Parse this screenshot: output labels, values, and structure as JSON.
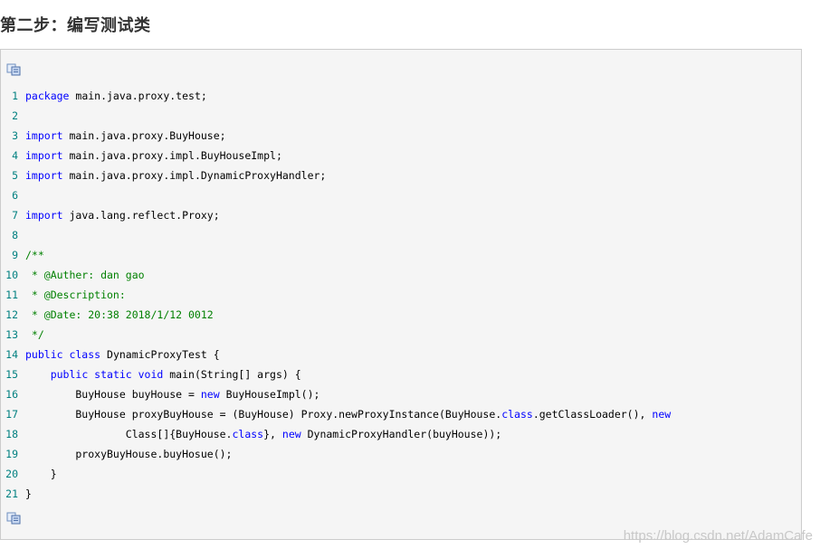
{
  "heading": "第二步：编写测试类",
  "watermark": "https://blog.csdn.net/AdamCafe",
  "copy_icon": "copy-code-icon",
  "lines": [
    {
      "n": "1",
      "tokens": [
        [
          "kw",
          "package"
        ],
        [
          "tx",
          " main.java.proxy.test;"
        ]
      ]
    },
    {
      "n": "2",
      "tokens": []
    },
    {
      "n": "3",
      "tokens": [
        [
          "kw",
          "import"
        ],
        [
          "tx",
          " main.java.proxy.BuyHouse;"
        ]
      ]
    },
    {
      "n": "4",
      "tokens": [
        [
          "kw",
          "import"
        ],
        [
          "tx",
          " main.java.proxy.impl.BuyHouseImpl;"
        ]
      ]
    },
    {
      "n": "5",
      "tokens": [
        [
          "kw",
          "import"
        ],
        [
          "tx",
          " main.java.proxy.impl.DynamicProxyHandler;"
        ]
      ]
    },
    {
      "n": "6",
      "tokens": []
    },
    {
      "n": "7",
      "tokens": [
        [
          "kw",
          "import"
        ],
        [
          "tx",
          " java.lang.reflect.Proxy;"
        ]
      ]
    },
    {
      "n": "8",
      "tokens": []
    },
    {
      "n": "9",
      "tokens": [
        [
          "cm",
          "/**"
        ]
      ]
    },
    {
      "n": "10",
      "tokens": [
        [
          "cm",
          " * @Auther: dan gao"
        ]
      ]
    },
    {
      "n": "11",
      "tokens": [
        [
          "cm",
          " * @Description:"
        ]
      ]
    },
    {
      "n": "12",
      "tokens": [
        [
          "cm",
          " * @Date: 20:38 2018/1/12 0012"
        ]
      ]
    },
    {
      "n": "13",
      "tokens": [
        [
          "cm",
          " */"
        ]
      ]
    },
    {
      "n": "14",
      "tokens": [
        [
          "kw",
          "public class"
        ],
        [
          "tx",
          " DynamicProxyTest {"
        ]
      ]
    },
    {
      "n": "15",
      "tokens": [
        [
          "tx",
          "    "
        ],
        [
          "kw",
          "public static void"
        ],
        [
          "tx",
          " main(String[] args) {"
        ]
      ]
    },
    {
      "n": "16",
      "tokens": [
        [
          "tx",
          "        BuyHouse buyHouse = "
        ],
        [
          "kw",
          "new"
        ],
        [
          "tx",
          " BuyHouseImpl();"
        ]
      ]
    },
    {
      "n": "17",
      "tokens": [
        [
          "tx",
          "        BuyHouse proxyBuyHouse = (BuyHouse) Proxy.newProxyInstance(BuyHouse."
        ],
        [
          "kw",
          "class"
        ],
        [
          "tx",
          ".getClassLoader(), "
        ],
        [
          "kw",
          "new"
        ]
      ]
    },
    {
      "n": "18",
      "tokens": [
        [
          "tx",
          "                Class[]{BuyHouse."
        ],
        [
          "kw",
          "class"
        ],
        [
          "tx",
          "}, "
        ],
        [
          "kw",
          "new"
        ],
        [
          "tx",
          " DynamicProxyHandler(buyHouse));"
        ]
      ]
    },
    {
      "n": "19",
      "tokens": [
        [
          "tx",
          "        proxyBuyHouse.buyHosue();"
        ]
      ]
    },
    {
      "n": "20",
      "tokens": [
        [
          "tx",
          "    }"
        ]
      ]
    },
    {
      "n": "21",
      "tokens": [
        [
          "tx",
          "}"
        ]
      ]
    }
  ]
}
